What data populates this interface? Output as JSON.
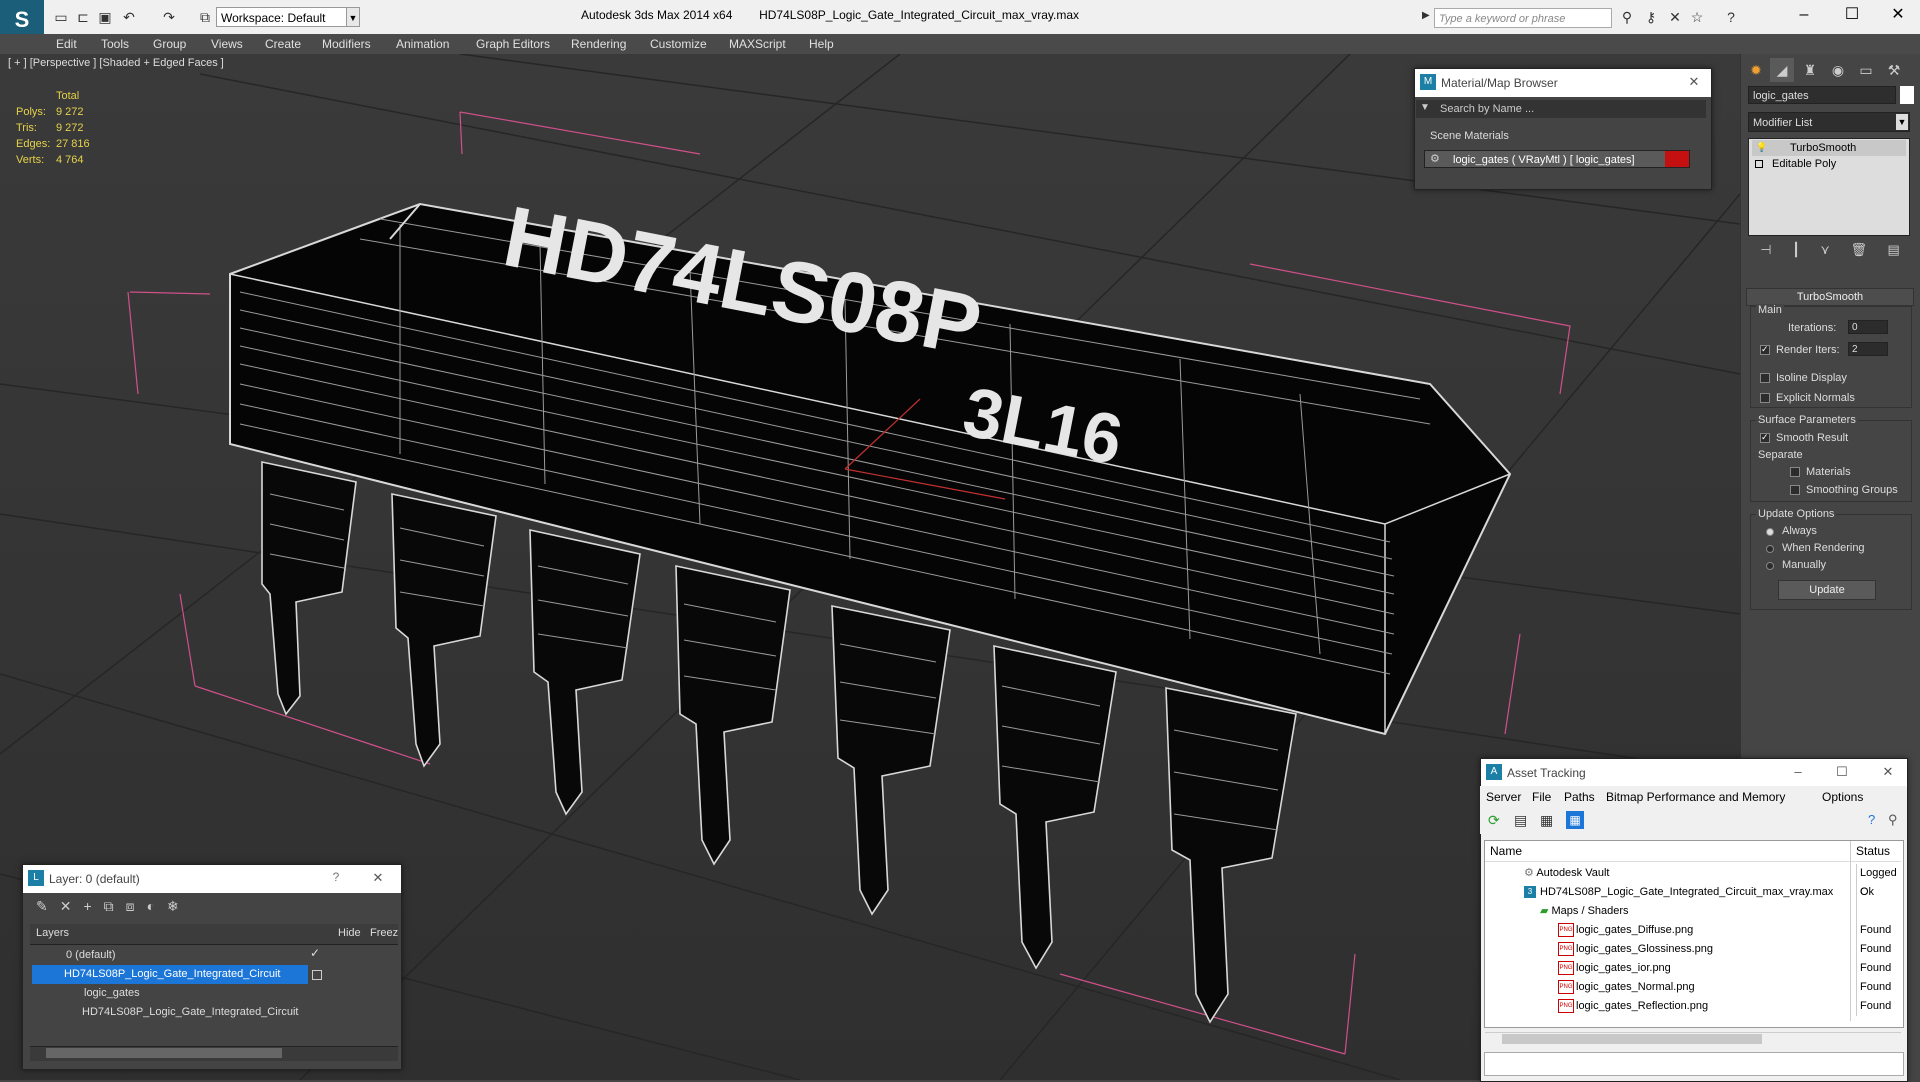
{
  "titlebar": {
    "app_title": "Autodesk 3ds Max  2014 x64",
    "file_name": "HD74LS08P_Logic_Gate_Integrated_Circuit_max_vray.max",
    "workspace": "Workspace: Default",
    "search_placeholder": "Type a keyword or phrase"
  },
  "menu": [
    "Edit",
    "Tools",
    "Group",
    "Views",
    "Create",
    "Modifiers",
    "Animation",
    "Graph Editors",
    "Rendering",
    "Customize",
    "MAXScript",
    "Help"
  ],
  "viewport": {
    "label": "[ + ] [Perspective ] [Shaded + Edged Faces ]",
    "stats_header": "Total",
    "stats": [
      {
        "label": "Polys:",
        "value": "9 272"
      },
      {
        "label": "Tris:",
        "value": "9 272"
      },
      {
        "label": "Edges:",
        "value": "27 816"
      },
      {
        "label": "Verts:",
        "value": "4 764"
      }
    ],
    "chip_text_main": "HD74LS08P",
    "chip_text_sub": "3L16"
  },
  "command_panel": {
    "object_name": "logic_gates",
    "modifier_list": "Modifier List",
    "stack": [
      "TurboSmooth",
      "Editable Poly"
    ],
    "rollout_title": "TurboSmooth",
    "main_label": "Main",
    "iterations_label": "Iterations:",
    "iterations_value": "0",
    "render_iters_label": "Render Iters:",
    "render_iters_value": "2",
    "isoline_label": "Isoline Display",
    "explicit_normals_label": "Explicit Normals",
    "surface_params_label": "Surface Parameters",
    "smooth_result_label": "Smooth Result",
    "separate_label": "Separate",
    "materials_label": "Materials",
    "smoothing_groups_label": "Smoothing Groups",
    "update_options_label": "Update Options",
    "always_label": "Always",
    "when_rendering_label": "When Rendering",
    "manually_label": "Manually",
    "update_button": "Update"
  },
  "material_browser": {
    "title": "Material/Map Browser",
    "search_placeholder": "Search by Name ...",
    "group": "Scene Materials",
    "item": "logic_gates  ( VRayMtl ) [ logic_gates]"
  },
  "layer_dialog": {
    "title": "Layer: 0 (default)",
    "col_layers": "Layers",
    "col_hide": "Hide",
    "col_freeze": "Freez",
    "rows": [
      "0 (default)",
      "HD74LS08P_Logic_Gate_Integrated_Circuit",
      "logic_gates",
      "HD74LS08P_Logic_Gate_Integrated_Circuit"
    ]
  },
  "asset_tracking": {
    "title": "Asset Tracking",
    "menu": [
      "Server",
      "File",
      "Paths",
      "Bitmap Performance and Memory",
      "Options"
    ],
    "col_name": "Name",
    "col_status": "Status",
    "rows": [
      {
        "name": "Autodesk Vault",
        "status": "Logged C"
      },
      {
        "name": "HD74LS08P_Logic_Gate_Integrated_Circuit_max_vray.max",
        "status": "Ok"
      },
      {
        "name": "Maps / Shaders",
        "status": ""
      },
      {
        "name": "logic_gates_Diffuse.png",
        "status": "Found"
      },
      {
        "name": "logic_gates_Glossiness.png",
        "status": "Found"
      },
      {
        "name": "logic_gates_ior.png",
        "status": "Found"
      },
      {
        "name": "logic_gates_Normal.png",
        "status": "Found"
      },
      {
        "name": "logic_gates_Reflection.png",
        "status": "Found"
      }
    ]
  },
  "colors": {
    "accent": "#1c76d8",
    "selection_box": "#d0508a",
    "stats": "#e5d24a",
    "material_swatch": "#c41010"
  }
}
